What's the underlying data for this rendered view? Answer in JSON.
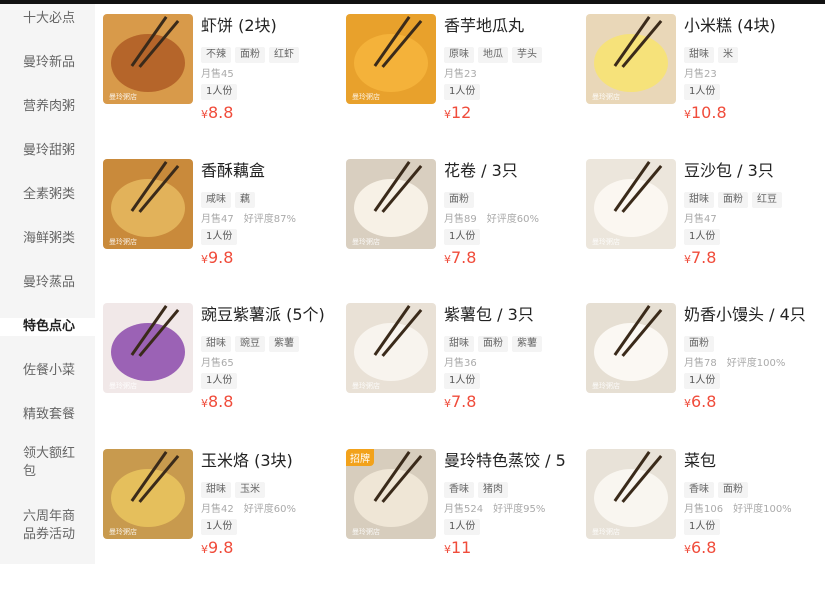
{
  "sidebar": {
    "items": [
      {
        "label": "十大必点"
      },
      {
        "label": "曼玲新品"
      },
      {
        "label": "营养肉粥"
      },
      {
        "label": "曼玲甜粥"
      },
      {
        "label": "全素粥类"
      },
      {
        "label": "海鲜粥类"
      },
      {
        "label": "曼玲蒸品"
      },
      {
        "label": "特色点心",
        "active": true
      },
      {
        "label": "佐餐小菜"
      },
      {
        "label": "精致套餐"
      },
      {
        "label": "领大额红包"
      },
      {
        "label": "六周年商品券活动"
      }
    ]
  },
  "currency": "¥",
  "products": [
    {
      "name": "虾饼 (2块)",
      "tags": [
        "不辣",
        "面粉",
        "红虾"
      ],
      "sales": "月售45",
      "rating": "",
      "serving": "1人份",
      "price": "8.8",
      "food_color": "#d89a4a",
      "plate_color": "#b5652a"
    },
    {
      "name": "香芋地瓜丸",
      "tags": [
        "原味",
        "地瓜",
        "芋头"
      ],
      "sales": "月售23",
      "rating": "",
      "serving": "1人份",
      "price": "12",
      "food_color": "#e8a12c",
      "plate_color": "#f4b23a"
    },
    {
      "name": "小米糕 (4块)",
      "tags": [
        "甜味",
        "米"
      ],
      "sales": "月售23",
      "rating": "",
      "serving": "1人份",
      "price": "10.8",
      "food_color": "#e9d7b8",
      "plate_color": "#f6e27a"
    },
    {
      "name": "香酥藕盒",
      "tags": [
        "咸味",
        "藕"
      ],
      "sales": "月售47",
      "rating": "好评度87%",
      "serving": "1人份",
      "price": "9.8",
      "food_color": "#c98a3b",
      "plate_color": "#e2b25a"
    },
    {
      "name": "花卷 / 3只",
      "tags": [
        "面粉"
      ],
      "sales": "月售89",
      "rating": "好评度60%",
      "serving": "1人份",
      "price": "7.8",
      "food_color": "#d9cfc0",
      "plate_color": "#f7f1e6"
    },
    {
      "name": "豆沙包 / 3只",
      "tags": [
        "甜味",
        "面粉",
        "红豆"
      ],
      "sales": "月售47",
      "rating": "",
      "serving": "1人份",
      "price": "7.8",
      "food_color": "#ece6dc",
      "plate_color": "#fbf7f1"
    },
    {
      "name": "豌豆紫薯派 (5个)",
      "tags": [
        "甜味",
        "豌豆",
        "紫薯"
      ],
      "sales": "月售65",
      "rating": "",
      "serving": "1人份",
      "price": "8.8",
      "food_color": "#f1e8e8",
      "plate_color": "#9b62b5"
    },
    {
      "name": "紫薯包 / 3只",
      "tags": [
        "甜味",
        "面粉",
        "紫薯"
      ],
      "sales": "月售36",
      "rating": "",
      "serving": "1人份",
      "price": "7.8",
      "food_color": "#e9e1d6",
      "plate_color": "#f8f4ee"
    },
    {
      "name": "奶香小馒头 / 4只",
      "tags": [
        "面粉"
      ],
      "sales": "月售78",
      "rating": "好评度100%",
      "serving": "1人份",
      "price": "6.8",
      "food_color": "#e6dfd3",
      "plate_color": "#fbf8f3"
    },
    {
      "name": "玉米烙 (3块)",
      "tags": [
        "甜味",
        "玉米"
      ],
      "sales": "月售42",
      "rating": "好评度60%",
      "serving": "1人份",
      "price": "9.8",
      "food_color": "#c89a4e",
      "plate_color": "#e5bf5c"
    },
    {
      "name": "曼玲特色蒸饺 / 5",
      "tags": [
        "香味",
        "猪肉"
      ],
      "sales": "月售524",
      "rating": "好评度95%",
      "serving": "1人份",
      "price": "11",
      "food_color": "#d7cdbd",
      "plate_color": "#efe6d6",
      "badge": "招牌"
    },
    {
      "name": "菜包",
      "tags": [
        "香味",
        "面粉"
      ],
      "sales": "月售106",
      "rating": "好评度100%",
      "serving": "1人份",
      "price": "6.8",
      "food_color": "#e8e2d8",
      "plate_color": "#f9f6f0"
    }
  ],
  "thumb_brand": "曼玲粥店"
}
